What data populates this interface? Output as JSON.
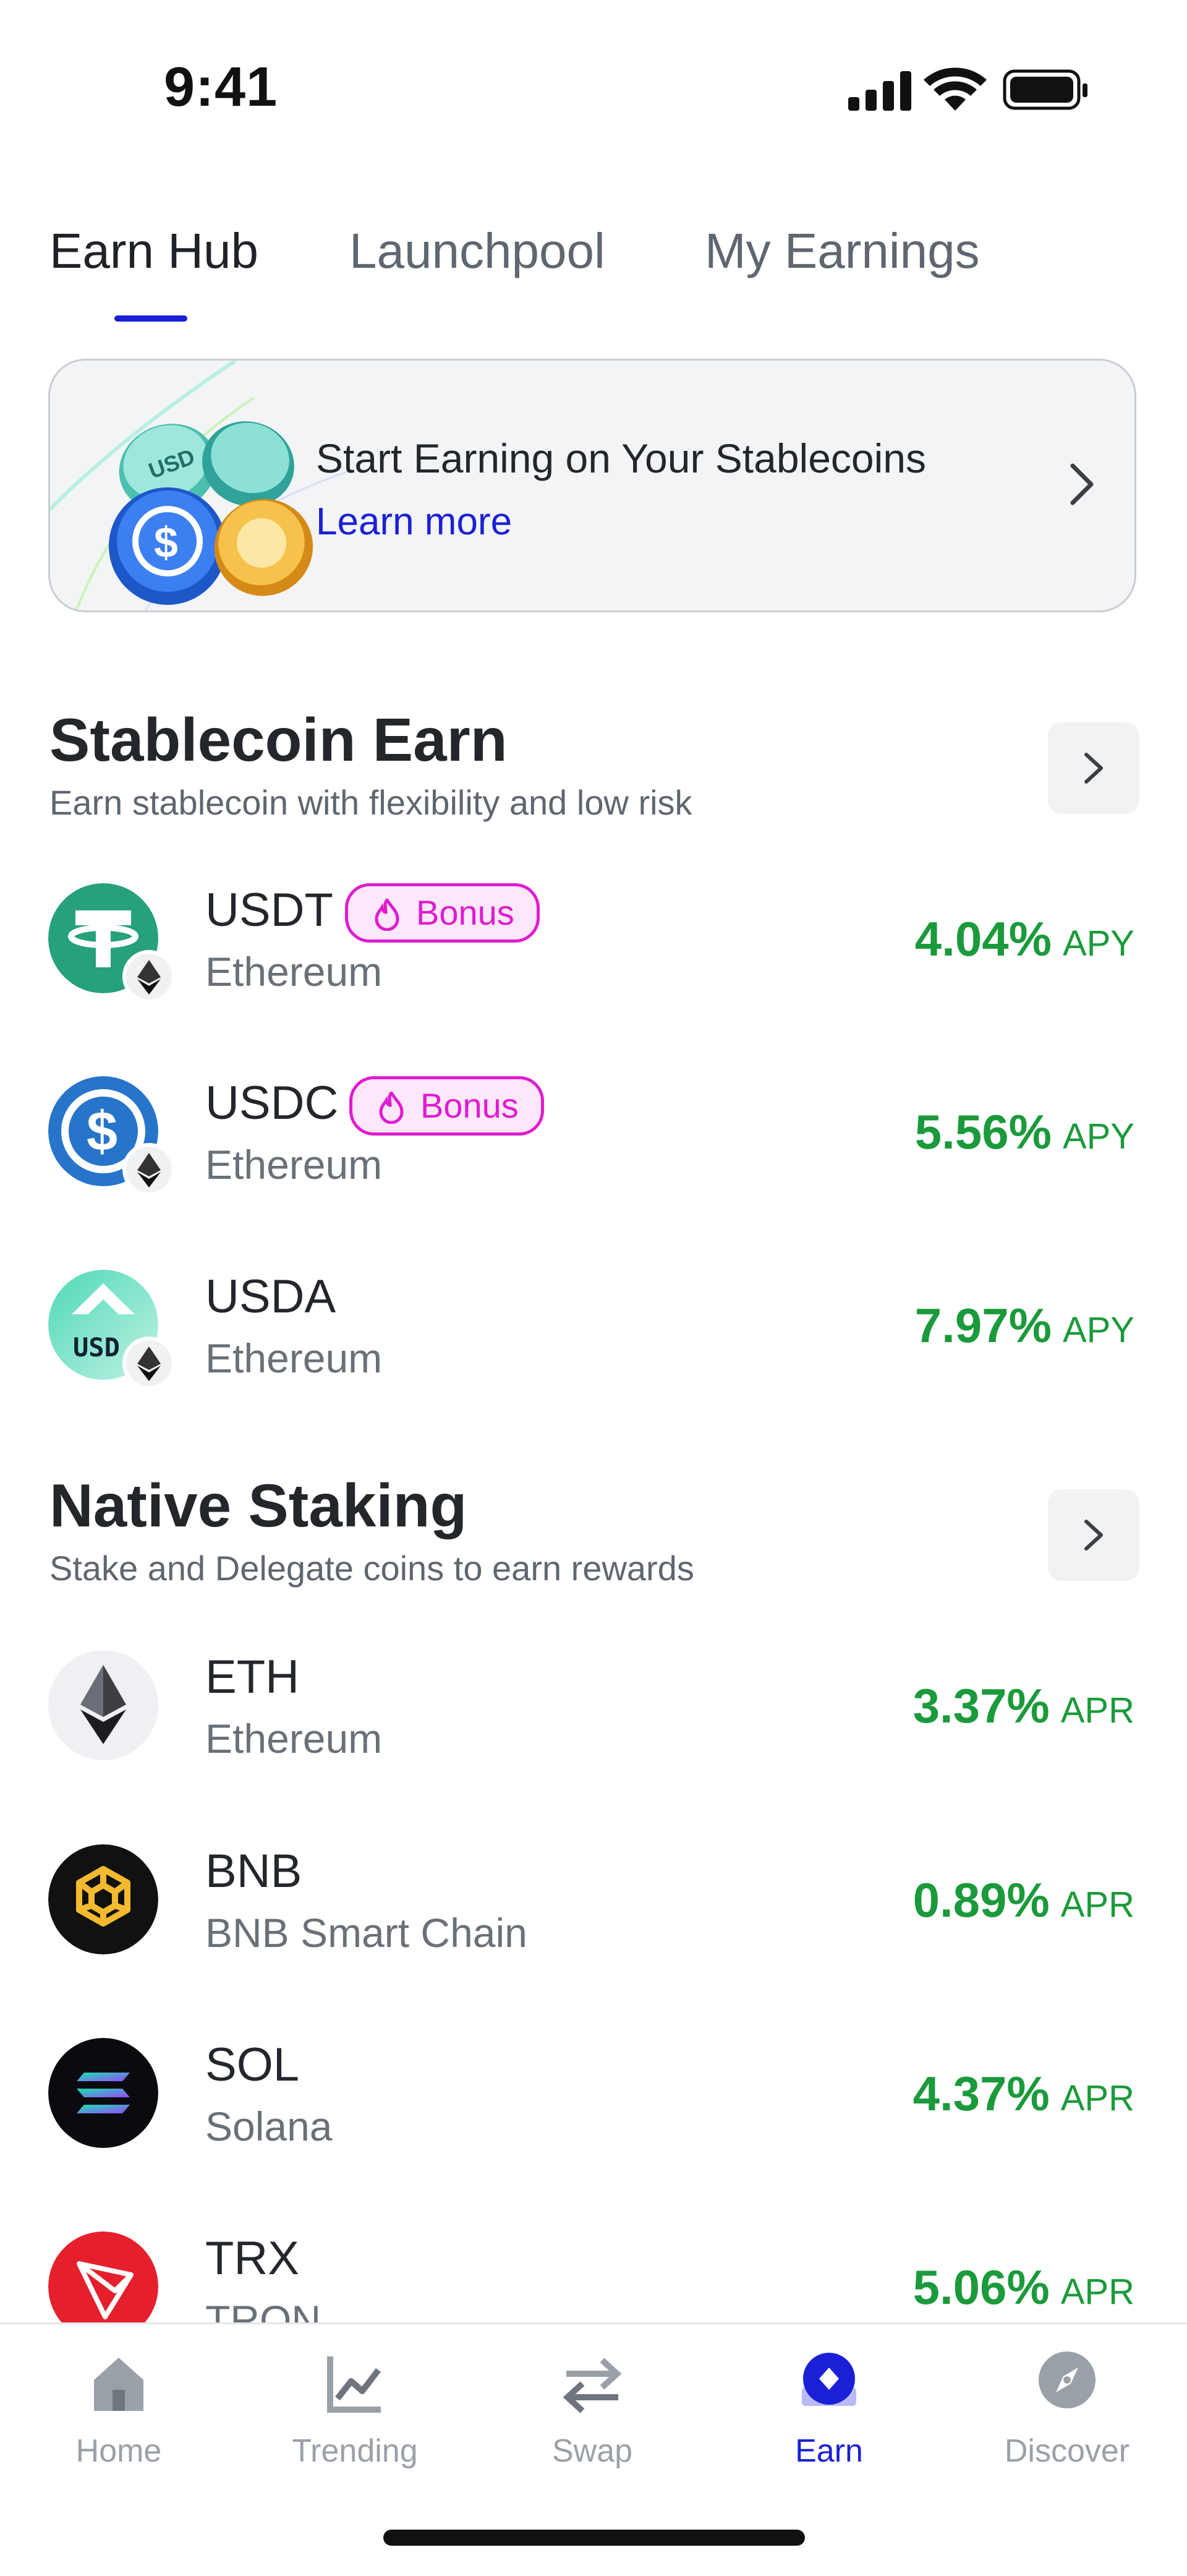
{
  "status_bar": {
    "time": "9:41"
  },
  "tabs": [
    {
      "label": "Earn Hub",
      "active": true
    },
    {
      "label": "Launchpool",
      "active": false
    },
    {
      "label": "My Earnings",
      "active": false
    }
  ],
  "banner": {
    "title": "Start Earning on Your Stablecoins",
    "link": "Learn more"
  },
  "stablecoin_section": {
    "title": "Stablecoin Earn",
    "subtitle": "Earn stablecoin with flexibility and low risk",
    "items": [
      {
        "symbol": "USDT",
        "network": "Ethereum",
        "rate": "4.04%",
        "unit": "APY",
        "badge": "Bonus"
      },
      {
        "symbol": "USDC",
        "network": "Ethereum",
        "rate": "5.56%",
        "unit": "APY",
        "badge": "Bonus"
      },
      {
        "symbol": "USDA",
        "network": "Ethereum",
        "rate": "7.97%",
        "unit": "APY",
        "badge": ""
      }
    ]
  },
  "staking_section": {
    "title": "Native Staking",
    "subtitle": "Stake and Delegate coins to earn rewards",
    "items": [
      {
        "symbol": "ETH",
        "network": "Ethereum",
        "rate": "3.37%",
        "unit": "APR"
      },
      {
        "symbol": "BNB",
        "network": "BNB Smart Chain",
        "rate": "0.89%",
        "unit": "APR"
      },
      {
        "symbol": "SOL",
        "network": "Solana",
        "rate": "4.37%",
        "unit": "APR"
      },
      {
        "symbol": "TRX",
        "network": "TRON",
        "rate": "5.06%",
        "unit": "APR"
      }
    ]
  },
  "bottom_nav": [
    {
      "label": "Home",
      "icon": "home-icon",
      "active": false
    },
    {
      "label": "Trending",
      "icon": "trending-icon",
      "active": false
    },
    {
      "label": "Swap",
      "icon": "swap-icon",
      "active": false
    },
    {
      "label": "Earn",
      "icon": "earn-icon",
      "active": true
    },
    {
      "label": "Discover",
      "icon": "compass-icon",
      "active": false
    }
  ],
  "colors": {
    "accent": "#1b20d6",
    "positive": "#1b9a3b",
    "bonus": "#e01bd0"
  }
}
